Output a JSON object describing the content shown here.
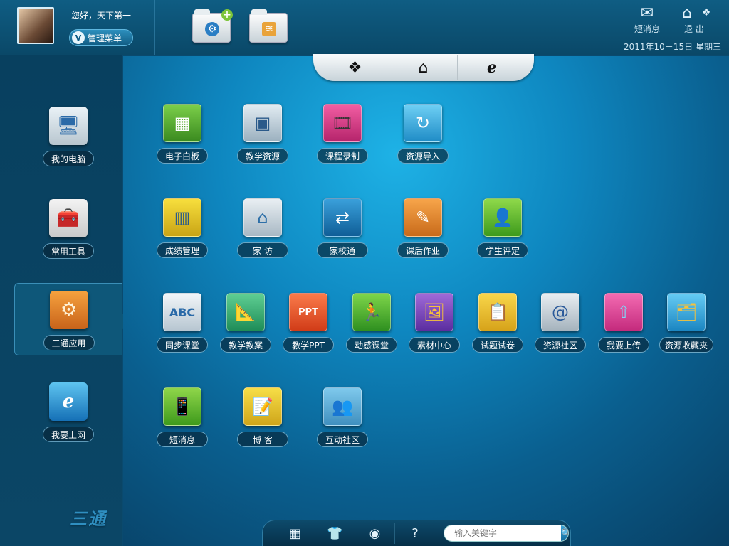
{
  "header": {
    "greeting": "您好，天下第一",
    "menu_label": "管理菜单",
    "sms_label": "短消息",
    "logout_label": "退 出",
    "date": "2011年10－15日",
    "weekday": "星期三"
  },
  "sidebar": {
    "items": [
      {
        "label": "我的电脑",
        "icon": "computer-icon"
      },
      {
        "label": "常用工具",
        "icon": "toolbox-icon"
      },
      {
        "label": "三通应用",
        "icon": "gears-icon"
      },
      {
        "label": "我要上网",
        "icon": "ie-icon"
      }
    ],
    "brand": "三通"
  },
  "apps": [
    {
      "label": "电子白板",
      "icon": "whiteboard-icon"
    },
    {
      "label": "教学资源",
      "icon": "teaching-resources-icon"
    },
    {
      "label": "课程录制",
      "icon": "film-icon"
    },
    {
      "label": "资源导入",
      "icon": "import-icon"
    },
    {
      "label": "成绩管理",
      "icon": "grades-icon"
    },
    {
      "label": "家  访",
      "icon": "house-icon"
    },
    {
      "label": "家校通",
      "icon": "network-icon"
    },
    {
      "label": "课后作业",
      "icon": "homework-icon"
    },
    {
      "label": "学生评定",
      "icon": "student-icon"
    },
    {
      "label": "同步课堂",
      "icon": "abc-icon"
    },
    {
      "label": "教学教案",
      "icon": "lesson-plan-icon"
    },
    {
      "label": "教学PPT",
      "icon": "ppt-icon"
    },
    {
      "label": "动感课堂",
      "icon": "dynamic-class-icon"
    },
    {
      "label": "素材中心",
      "icon": "photos-icon"
    },
    {
      "label": "试题试卷",
      "icon": "clipboard-icon"
    },
    {
      "label": "资源社区",
      "icon": "address-book-icon"
    },
    {
      "label": "我要上传",
      "icon": "upload-icon"
    },
    {
      "label": "资源收藏夹",
      "icon": "favorites-folder-icon"
    },
    {
      "label": "短消息",
      "icon": "phone-icon"
    },
    {
      "label": "博  客",
      "icon": "blog-icon"
    },
    {
      "label": "互动社区",
      "icon": "community-icon"
    }
  ],
  "search": {
    "placeholder": "输入关键字"
  }
}
